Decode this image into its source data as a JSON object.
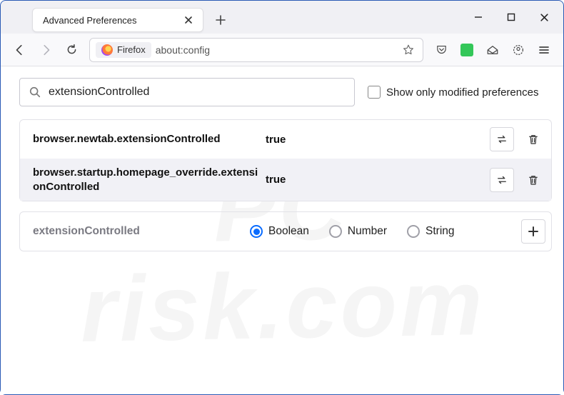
{
  "tab": {
    "title": "Advanced Preferences"
  },
  "urlbar": {
    "chip": "Firefox",
    "url": "about:config"
  },
  "search": {
    "value": "extensionControlled",
    "checkbox_label": "Show only modified preferences",
    "checked": false
  },
  "prefs": [
    {
      "name": "browser.newtab.extensionControlled",
      "value": "true"
    },
    {
      "name": "browser.startup.homepage_override.extensionControlled",
      "value": "true"
    }
  ],
  "newpref": {
    "name": "extensionControlled",
    "types": {
      "boolean": "Boolean",
      "number": "Number",
      "string": "String"
    },
    "selected": "boolean"
  },
  "watermark": {
    "line1": "PC",
    "line2": "risk.com"
  }
}
